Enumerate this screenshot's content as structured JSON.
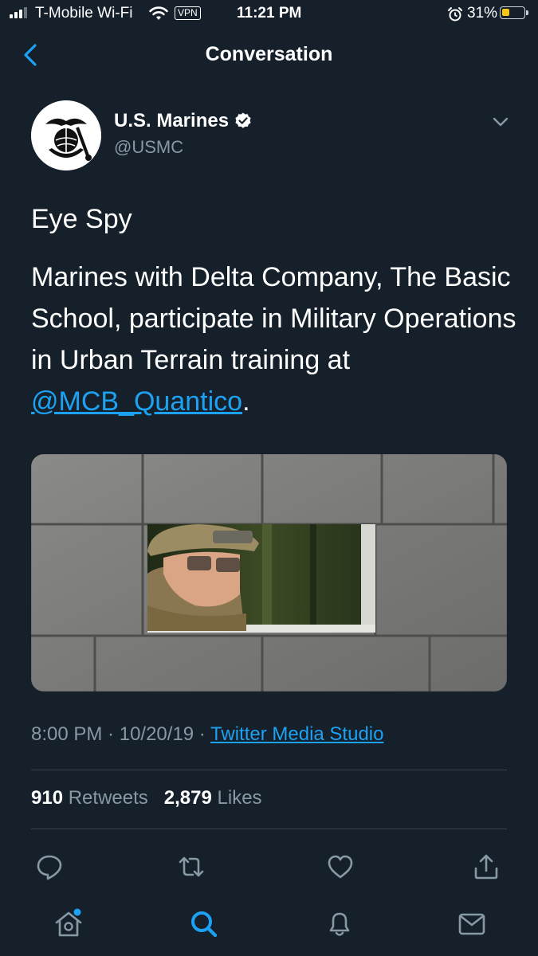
{
  "status_bar": {
    "carrier": "T-Mobile Wi-Fi",
    "vpn": "VPN",
    "time": "11:21 PM",
    "battery": "31%",
    "battery_level": 0.31,
    "icons": [
      "signal-icon",
      "wifi-icon",
      "alarm-icon",
      "battery-icon"
    ]
  },
  "nav": {
    "title": "Conversation",
    "back_icon": "chevron-left-icon"
  },
  "tweet": {
    "author_name": "U.S. Marines",
    "handle": "@USMC",
    "verified": true,
    "text_line1": "Eye Spy",
    "text_body": "Marines with Delta Company, The Basic School, participate in Military Operations in Urban Terrain training at ",
    "mention": "@MCB_Quantico",
    "text_end": ".",
    "time": "8:00 PM",
    "date": "10/20/19",
    "source": "Twitter Media Studio",
    "retweets_count": "910",
    "retweets_label": "Retweets",
    "likes_count": "2,879",
    "likes_label": "Likes"
  },
  "actions": [
    "reply-icon",
    "retweet-icon",
    "like-icon",
    "share-icon"
  ],
  "tab_bar": [
    "home-icon",
    "search-icon",
    "notifications-icon",
    "messages-icon"
  ],
  "colors": {
    "background": "#15202b",
    "accent": "#1da1f2",
    "secondary_text": "#8899a6",
    "divider": "#38444d"
  }
}
